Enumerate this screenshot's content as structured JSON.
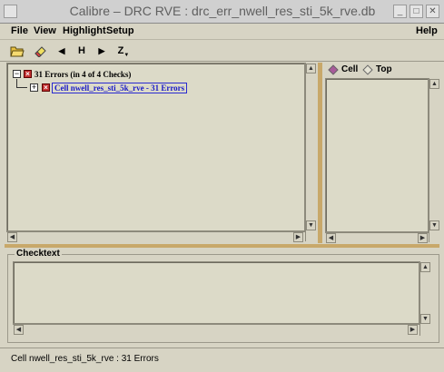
{
  "window": {
    "title": "Calibre – DRC RVE : drc_err_nwell_res_sti_5k_rve.db"
  },
  "menu": {
    "file": "File",
    "view": "View",
    "highlight": "Highlight",
    "setup": "Setup",
    "help": "Help"
  },
  "toolbar": {
    "h_label": "H",
    "z_label": "Z"
  },
  "tree": {
    "root_label": "31 Errors (in 4 of 4 Checks)",
    "child_label": "Cell nwell_res_sti_5k_rve - 31 Errors"
  },
  "view_options": {
    "cell_label": "Cell",
    "top_label": "Top"
  },
  "checktext": {
    "label": "Checktext"
  },
  "status": {
    "text": "Cell nwell_res_sti_5k_rve : 31 Errors"
  },
  "colors": {
    "background": "#d7d4c4",
    "selection_text": "#1a1ac8",
    "error_box": "#c23030",
    "splitter": "#c8a86a"
  }
}
